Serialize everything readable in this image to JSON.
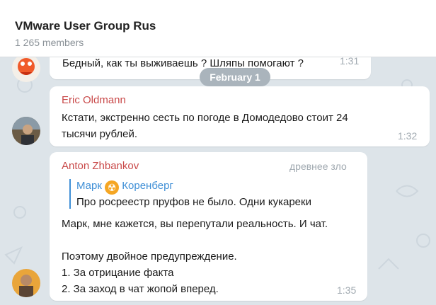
{
  "header": {
    "title": "VMware User Group Rus",
    "members": "1 265 members"
  },
  "date_pill": "February 1",
  "messages": [
    {
      "text": "Бедный, как ты выживаешь ? Шляпы помогают ?",
      "time": "1:31"
    },
    {
      "sender": "Eric Oldmann",
      "text": "Кстати, экстренно сесть по погоде в Домодедово стоит 24\nтысячи рублей.",
      "time": "1:32"
    },
    {
      "sender": "Anton Zhbankov",
      "badge": "древнее зло",
      "quote": {
        "name_part1": "Марк",
        "name_part2": "Коренберг",
        "emoji": "☢",
        "text": "Про росреестр пруфов не было. Одни кукареки"
      },
      "text": "Марк, мне кажется, вы перепутали реальность. И чат.\n\nПоэтому двойное предупреждение.\n1. За отрицание факта\n2. За заход в чат жопой вперед.",
      "time": "1:35"
    }
  ],
  "colors": {
    "eric": "#c94a4a",
    "anton": "#c94a4a",
    "quote": "#3f8fd6"
  }
}
